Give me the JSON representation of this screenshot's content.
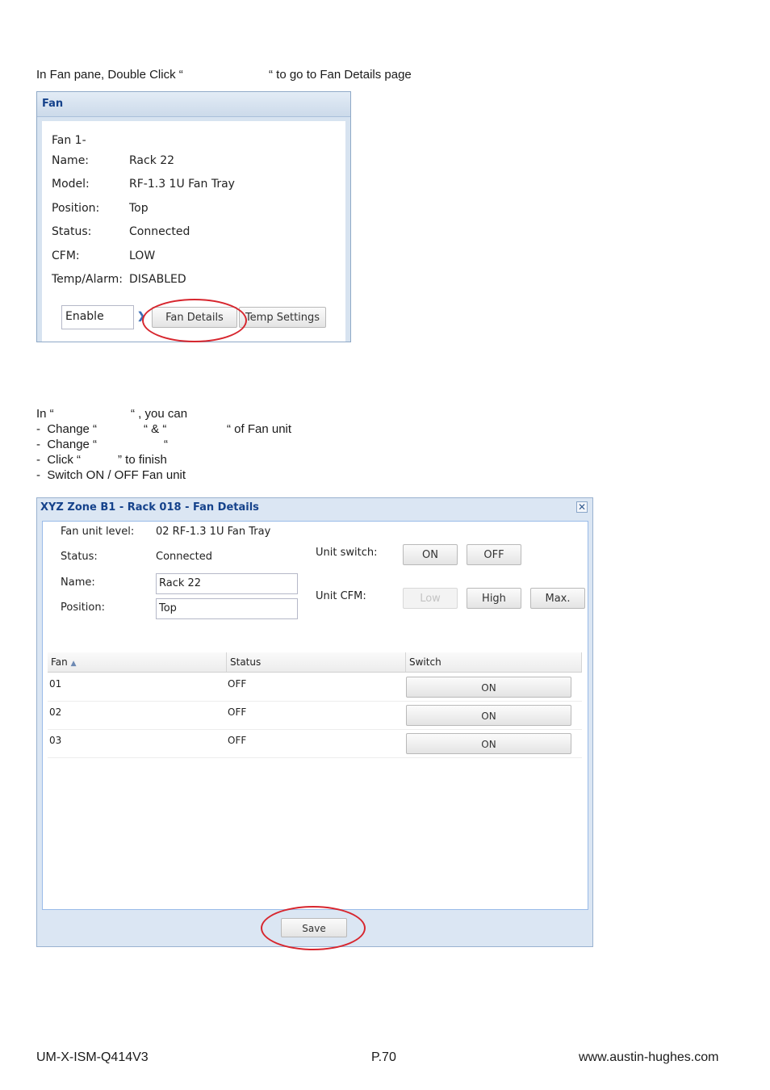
{
  "instructions": {
    "line1_pre": "In Fan pane, Double Click “",
    "line1_post": "“ to go to Fan Details page",
    "intro_pre": "In “",
    "intro_post": "“ , you can",
    "bullet1_pre": "-  Change “",
    "bullet1_mid": "“ & “",
    "bullet1_post": "“ of Fan unit",
    "bullet2_pre": "-  Change “",
    "bullet2_post": "“",
    "bullet3_pre": "-  Click “",
    "bullet3_post": "” to finish",
    "bullet4": "-  Switch ON / OFF Fan unit"
  },
  "fan_pane": {
    "title": "Fan",
    "heading": "Fan 1-",
    "rows": [
      {
        "label": "Name:",
        "value": "Rack 22"
      },
      {
        "label": "Model:",
        "value": "RF-1.3 1U Fan Tray"
      },
      {
        "label": "Position:",
        "value": "Top"
      },
      {
        "label": "Status:",
        "value": "Connected"
      },
      {
        "label": "CFM:",
        "value": "LOW"
      },
      {
        "label": "Temp/Alarm:",
        "value": "DISABLED"
      }
    ],
    "select_value": "Enable",
    "fan_details_button": "Fan Details",
    "temp_settings_button": "Temp Settings"
  },
  "details_window": {
    "title": "XYZ Zone B1 - Rack 018 - Fan Details",
    "fan_unit_level_label": "Fan unit level:",
    "fan_unit_level_value": "02 RF-1.3 1U Fan Tray",
    "status_label": "Status:",
    "status_value": "Connected",
    "name_label": "Name:",
    "name_value": "Rack 22",
    "position_label": "Position:",
    "position_value": "Top",
    "unit_switch_label": "Unit switch:",
    "on_button": "ON",
    "off_button": "OFF",
    "unit_cfm_label": "Unit CFM:",
    "low_button": "Low",
    "high_button": "High",
    "max_button": "Max.",
    "grid_headers": {
      "fan": "Fan",
      "status": "Status",
      "switch": "Switch"
    },
    "grid_rows": [
      {
        "fan": "01",
        "status": "OFF",
        "switch": "ON"
      },
      {
        "fan": "02",
        "status": "OFF",
        "switch": "ON"
      },
      {
        "fan": "03",
        "status": "OFF",
        "switch": "ON"
      }
    ],
    "save_button": "Save"
  },
  "footer": {
    "doc_id": "UM-X-ISM-Q414V3",
    "page": "P.70",
    "website": "www.austin-hughes.com"
  },
  "colors": {
    "header_text": "#15428b",
    "highlight_ring": "#d7262e"
  }
}
